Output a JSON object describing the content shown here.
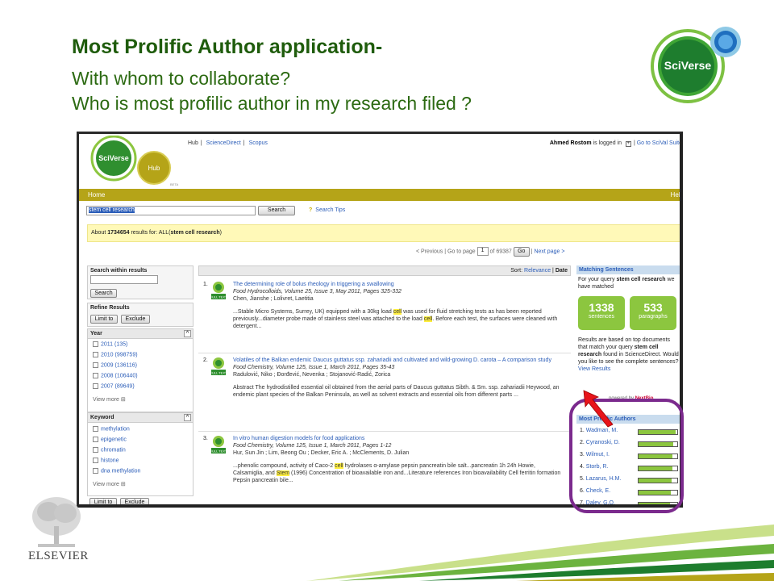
{
  "slide": {
    "title": "Most Prolific Author application-",
    "line1": "With whom to collaborate?",
    "line2": "Who is most profilic author in my research filed ?",
    "logo_text": "SciVerse",
    "publisher": "ELSEVIER"
  },
  "app": {
    "brand": "SciVerse",
    "hub_badge": "Hub",
    "hub_beta": "BETA",
    "top_links": [
      "Hub",
      "ScienceDirect",
      "Scopus"
    ],
    "user_text": "Ahmed Rostom",
    "user_suffix": "is logged in",
    "suite_link": "Go to SciVal Suite",
    "nav_home": "Home",
    "nav_help": "Help",
    "search_value": "stem cell research",
    "search_button": "Search",
    "search_tips": "Search Tips",
    "results_prefix": "About",
    "results_count": "1734654",
    "results_middle": "results for: ALL(",
    "results_query": "stem cell research",
    "results_suffix": ")",
    "pager_prev": "< Previous",
    "pager_goto": "Go to page",
    "pager_page": "1",
    "pager_of": "of 69387",
    "pager_go": "Go",
    "pager_next": "Next page >",
    "accent_nav": "#b5a418",
    "accent_green": "#8cc63f"
  },
  "left": {
    "within_title": "Search within results",
    "within_button": "Search",
    "refine_title": "Refine Results",
    "limit_button": "Limit to",
    "exclude_button": "Exclude",
    "year_title": "Year",
    "years": [
      "2011 (135)",
      "2010 (998759)",
      "2009 (136116)",
      "2008 (106440)",
      "2007 (89649)"
    ],
    "view_more": "View more",
    "keyword_title": "Keyword",
    "keywords": [
      "methylation",
      "epigenetic",
      "chromatin",
      "histone",
      "dna methylation"
    ],
    "view_more2": "View more",
    "limit_button2": "Limit to",
    "exclude_button2": "Exclude"
  },
  "middle": {
    "sort_label": "Sort:",
    "sort_relevance": "Relevance",
    "sort_date": "Date",
    "results": [
      {
        "num": "1.",
        "title": "The determining role of bolus rheology in triggering a swallowing",
        "source": "Food Hydrocolloids, Volume 25, Issue 3, May 2011, Pages 325-332",
        "authors": "Chen, Jianshe ; Lolivret, Laetitia",
        "abstract_a": "...Stable Micro Systems, Surrey, UK) equipped with a 30kg load ",
        "abstract_hl1": "cell",
        "abstract_b": " was used for fluid stretching tests as has been reported previously...diameter probe made of stainless steel was attached to the load ",
        "abstract_hl2": "cell",
        "abstract_c": ". Before each test, the surfaces were cleaned with detergent..."
      },
      {
        "num": "2.",
        "title": "Volatiles of the Balkan endemic Daucus guttatus ssp. zahariadii and cultivated and wild-growing D. carota – A comparison study",
        "source": "Food Chemistry, Volume 125, Issue 1, March 2011, Pages 35-43",
        "authors": "Radulović, Niko ; Đorđević, Nevenka ; Stojanović-Radić, Zorica",
        "abstract_a": "Abstract The hydrodistilled essential oil obtained from the aerial parts of Daucus guttatus Sibth. & Sm. ssp. zahariadii Heywood, an endemic plant species of the Balkan Peninsula, as well as solvent extracts and essential oils from different parts ...",
        "abstract_hl1": "",
        "abstract_b": "",
        "abstract_hl2": "",
        "abstract_c": ""
      },
      {
        "num": "3.",
        "title": "In vitro human digestion models for food applications",
        "source": "Food Chemistry, Volume 125, Issue 1, March 2011, Pages 1-12",
        "authors": "Hur, Sun Jin ; Lim, Beong Ou ; Decker, Eric A. ; McClements, D. Julian",
        "abstract_a": "...phenolic compound, activity of Caco-2 ",
        "abstract_hl1": "cell",
        "abstract_b": " hydrolases α-amylase pepsin pancreatin bile salt...pancreatin 1h 24h Howie, Calsamiglia, and ",
        "abstract_hl2": "Stem",
        "abstract_c": " (1996) Concentration of bioavailable iron and...Literature references Iron bioavailability Cell ferritin formation Pepsin pancreatin bile..."
      }
    ]
  },
  "right": {
    "ms_title": "Matching Sentences",
    "ms_text_a": "For your query ",
    "ms_query": "stem cell research",
    "ms_text_b": " we have matched",
    "sentences_num": "1338",
    "sentences_label": "sentences",
    "paragraphs_num": "533",
    "paragraphs_label": "paragraphs",
    "based_a": "Results are based on top documents that match your query ",
    "based_query": "stem cell research",
    "based_b": " found in ScienceDirect. Would you like to see the complete sentences?",
    "view_results": "View Results",
    "powered": "powered by",
    "powered_brand": "NextBio",
    "mpa_title": "Most Prolific Authors",
    "authors": [
      {
        "num": "1.",
        "name": "Wadman, M.",
        "fill": 0.95
      },
      {
        "num": "2.",
        "name": "Cyranoski, D.",
        "fill": 0.9
      },
      {
        "num": "3.",
        "name": "Wilmut, I.",
        "fill": 0.88
      },
      {
        "num": "4.",
        "name": "Storb, R.",
        "fill": 0.88
      },
      {
        "num": "5.",
        "name": "Lazarus, H.M.",
        "fill": 0.85
      },
      {
        "num": "6.",
        "name": "Check, E.",
        "fill": 0.84
      },
      {
        "num": "7.",
        "name": "Daley, G.Q.",
        "fill": 0.82
      }
    ]
  }
}
